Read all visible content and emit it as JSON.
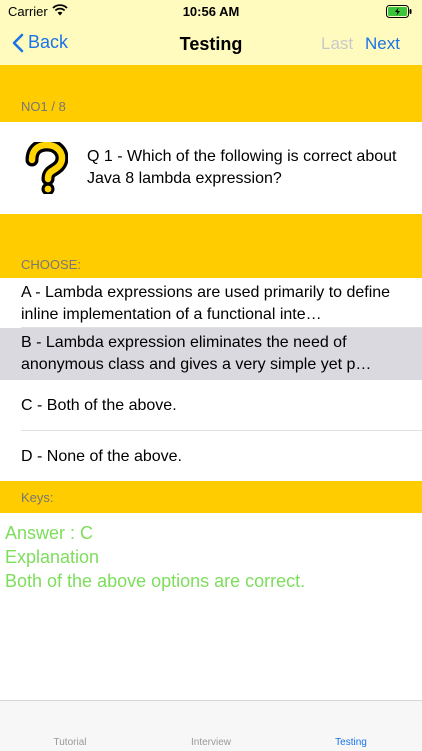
{
  "status": {
    "carrier": "Carrier",
    "time": "10:56 AM"
  },
  "nav": {
    "back": "Back",
    "title": "Testing",
    "last": "Last",
    "next": "Next"
  },
  "progress": {
    "label": "NO1 / 8"
  },
  "question": {
    "text": "Q 1 - Which of the following is correct about Java 8 lambda expression?",
    "icon": "question-mark-icon"
  },
  "choose_label": "CHOOSE:",
  "options": [
    {
      "text": "A - Lambda expressions are used primarily to define inline implementation of a functional inte…"
    },
    {
      "text": "B - Lambda expression eliminates the need of anonymous class and gives a very simple yet p…"
    },
    {
      "text": "C - Both of the above."
    },
    {
      "text": "D - None of the above."
    }
  ],
  "keys_label": "Keys:",
  "answer": {
    "line1": "Answer : C",
    "line2": "Explanation",
    "line3": "Both of the above options are correct."
  },
  "tabs": [
    {
      "label": "Tutorial"
    },
    {
      "label": "Interview"
    },
    {
      "label": "Testing"
    }
  ],
  "colors": {
    "accent": "#1a73e8",
    "section": "#ffcc00",
    "header_bg": "#fffbbf",
    "answer_green": "#7dde5c",
    "selected_row": "#d9d9df"
  }
}
